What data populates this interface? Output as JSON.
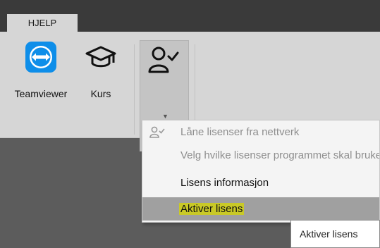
{
  "tabs": [
    {
      "label": "HJELP"
    }
  ],
  "ribbon": {
    "buttons": [
      {
        "label": "Teamviewer",
        "icon": "teamviewer-icon"
      },
      {
        "label": "Kurs",
        "icon": "graduation-cap-icon"
      }
    ],
    "license_button": {
      "icon": "user-check-icon",
      "dropdown_icon": "dropdown-arrow-icon"
    }
  },
  "menu": {
    "items": [
      {
        "label": "Låne lisenser fra nettverk",
        "state": "disabled",
        "icon": "user-check-icon"
      },
      {
        "label": "Velg hvilke lisenser programmet skal bruke",
        "state": "disabled"
      },
      {
        "label": "Lisens informasjon",
        "state": "enabled"
      },
      {
        "label": "Aktiver lisens",
        "state": "hovered"
      }
    ]
  },
  "tooltip": {
    "text": "Aktiver lisens"
  },
  "colors": {
    "teamviewer_blue": "#0e8ee9",
    "highlight_yellow": "#c9c927",
    "ribbon_bg": "#d6d6d6",
    "tabstrip_bg": "#3a3a3a"
  }
}
